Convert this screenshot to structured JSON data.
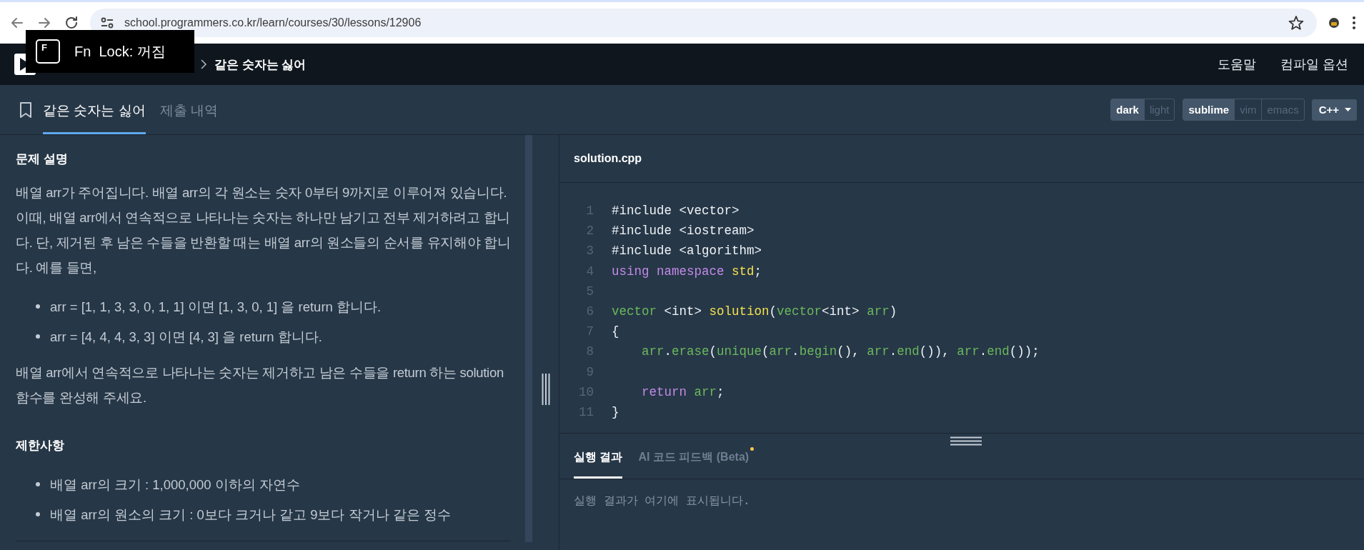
{
  "browser": {
    "url": "school.programmers.co.kr/learn/courses/30/lessons/12906"
  },
  "osd": {
    "key": "F",
    "text": "Fn  Lock: 꺼짐"
  },
  "nav": {
    "breadcrumb": "같은 숫자는 싫어",
    "links": [
      "도움말",
      "컴파일 옵션"
    ]
  },
  "tabs": [
    {
      "label": "같은 숫자는 싫어",
      "selected": true
    },
    {
      "label": "제출 내역",
      "selected": false
    }
  ],
  "theme": [
    {
      "label": "dark",
      "selected": true
    },
    {
      "label": "light",
      "selected": false
    }
  ],
  "keymap": [
    {
      "label": "sublime",
      "selected": true
    },
    {
      "label": "vim",
      "selected": false
    },
    {
      "label": "emacs",
      "selected": false
    }
  ],
  "language": "C++",
  "problem": {
    "sections": [
      {
        "heading": "문제 설명",
        "blocks": [
          {
            "kind": "p",
            "text": "배열 arr가 주어집니다. 배열 arr의 각 원소는 숫자 0부터 9까지로 이루어져 있습니다. 이때, 배열 arr에서 연속적으로 나타나는 숫자는 하나만 남기고 전부 제거하려고 합니다. 단, 제거된 후 남은 수들을 반환할 때는 배열 arr의 원소들의 순서를 유지해야 합니다. 예를 들면,"
          },
          {
            "kind": "list",
            "items": [
              "arr = [1, 1, 3, 3, 0, 1, 1] 이면 [1, 3, 0, 1] 을 return 합니다.",
              "arr = [4, 4, 4, 3, 3] 이면 [4, 3] 을 return 합니다."
            ]
          },
          {
            "kind": "p",
            "text": "배열 arr에서 연속적으로 나타나는 숫자는 제거하고 남은 수들을 return 하는 solution 함수를 완성해 주세요."
          }
        ]
      },
      {
        "heading": "제한사항",
        "blocks": [
          {
            "kind": "list",
            "items": [
              "배열 arr의 크기 : 1,000,000 이하의 자연수",
              "배열 arr의 원소의 크기 : 0보다 크거나 같고 9보다 작거나 같은 정수"
            ]
          }
        ]
      }
    ]
  },
  "editor": {
    "filename": "solution.cpp",
    "lines": [
      {
        "number": "1",
        "indented": false,
        "tokens": [
          {
            "text": "#include <vector>",
            "kind": "plain"
          }
        ]
      },
      {
        "number": "2",
        "indented": false,
        "tokens": [
          {
            "text": "#include <iostream>",
            "kind": "plain"
          }
        ]
      },
      {
        "number": "3",
        "indented": false,
        "tokens": [
          {
            "text": "#include <algorithm>",
            "kind": "plain"
          }
        ]
      },
      {
        "number": "4",
        "indented": false,
        "tokens": [
          {
            "text": "using namespace",
            "kind": "keyword"
          },
          {
            "text": "std",
            "kind": "function"
          },
          {
            "text": ";",
            "kind": "plain"
          }
        ]
      },
      {
        "number": "5"
      },
      {
        "number": "6",
        "indented": false,
        "tokens": [
          {
            "text": "vector",
            "kind": "type"
          },
          {
            "text": "<int>",
            "kind": "plain"
          },
          {
            "text": "solution",
            "kind": "function"
          },
          {
            "text": "(",
            "kind": "plain"
          },
          {
            "text": "vector",
            "kind": "type"
          },
          {
            "text": "<int>",
            "kind": "plain"
          },
          {
            "text": "arr",
            "kind": "type"
          },
          {
            "text": ")",
            "kind": "plain"
          }
        ]
      },
      {
        "number": "7",
        "indented": false,
        "tokens": [
          {
            "text": "{",
            "kind": "plain"
          }
        ]
      },
      {
        "number": "8",
        "indented": true,
        "tokens": [
          {
            "text": "arr",
            "kind": "type"
          },
          {
            "text": ".",
            "kind": "plain"
          },
          {
            "text": "erase",
            "kind": "type"
          },
          {
            "text": "(",
            "kind": "plain"
          },
          {
            "text": "unique",
            "kind": "type"
          },
          {
            "text": "(",
            "kind": "plain"
          },
          {
            "text": "arr",
            "kind": "type"
          },
          {
            "text": ".",
            "kind": "plain"
          },
          {
            "text": "begin",
            "kind": "type"
          },
          {
            "text": "(),",
            "kind": "plain"
          },
          {
            "text": "arr",
            "kind": "type"
          },
          {
            "text": ".",
            "kind": "plain"
          },
          {
            "text": "end",
            "kind": "type"
          },
          {
            "text": "()),",
            "kind": "plain"
          },
          {
            "text": "arr",
            "kind": "type"
          },
          {
            "text": ".",
            "kind": "plain"
          },
          {
            "text": "end",
            "kind": "type"
          },
          {
            "text": "());",
            "kind": "plain"
          }
        ]
      },
      {
        "number": "9"
      },
      {
        "number": "10",
        "indented": true,
        "tokens": [
          {
            "text": "return",
            "kind": "keyword"
          },
          {
            "text": "arr",
            "kind": "type"
          },
          {
            "text": ";",
            "kind": "plain"
          }
        ]
      },
      {
        "number": "11",
        "indented": false,
        "tokens": [
          {
            "text": "}",
            "kind": "plain"
          }
        ]
      }
    ]
  },
  "result_tabs": [
    {
      "label": "실행 결과",
      "selected": true,
      "new_dot": false
    },
    {
      "label": "AI 코드 피드백 (Beta)",
      "selected": false,
      "new_dot": true
    }
  ],
  "result": {
    "placeholder": "실행 결과가 여기에 표시됩니다."
  }
}
